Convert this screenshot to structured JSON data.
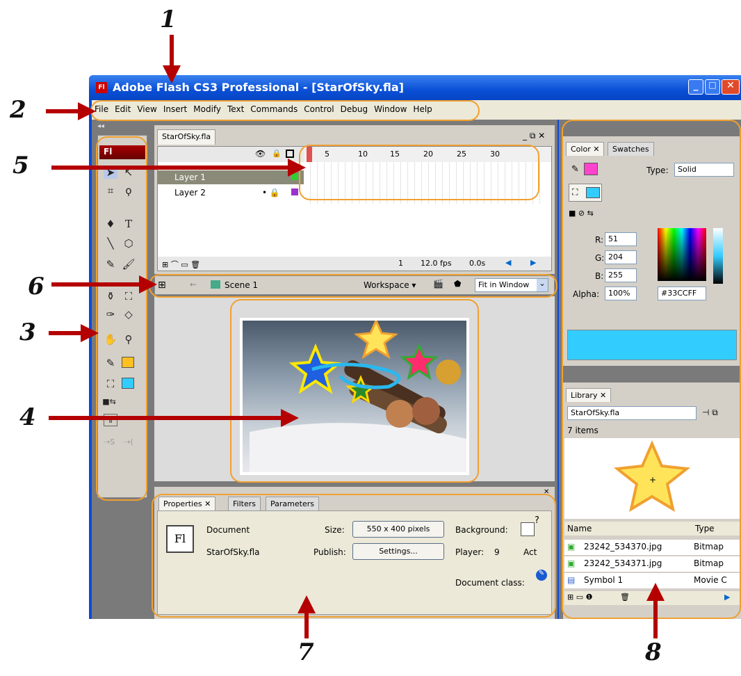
{
  "annotations": [
    "1",
    "2",
    "3",
    "4",
    "5",
    "6",
    "7",
    "8"
  ],
  "window": {
    "title": "Adobe Flash CS3 Professional - [StarOfSky.fla]",
    "app_icon": "Fl"
  },
  "menu": [
    "File",
    "Edit",
    "View",
    "Insert",
    "Modify",
    "Text",
    "Commands",
    "Control",
    "Debug",
    "Window",
    "Help"
  ],
  "toolbar": {
    "logo": "Fl",
    "collapse": "◂◂"
  },
  "document": {
    "tab": "StarOfSky.fla"
  },
  "timeline": {
    "frames": [
      "5",
      "10",
      "15",
      "20",
      "25",
      "30"
    ],
    "layers": [
      {
        "name": "Layer 1",
        "selected": true
      },
      {
        "name": "Layer 2",
        "selected": false
      }
    ],
    "current_frame": "1",
    "fps": "12.0 fps",
    "time": "0.0s"
  },
  "editbar": {
    "scene": "Scene 1",
    "workspace": "Workspace ▾",
    "zoom": "Fit in Window"
  },
  "properties": {
    "tabs": [
      "Properties",
      "Filters",
      "Parameters"
    ],
    "logo": "Fl",
    "doc_label": "Document",
    "doc_name": "StarOfSky.fla",
    "size_label": "Size:",
    "size_value": "550 x 400 pixels",
    "publish_label": "Publish:",
    "publish_value": "Settings...",
    "background_label": "Background:",
    "player_label": "Player:",
    "player_value": "9",
    "act": "Act",
    "doc_class_label": "Document class:"
  },
  "color": {
    "tabs": [
      "Color",
      "Swatches"
    ],
    "type_label": "Type:",
    "type_value": "Solid",
    "r_label": "R:",
    "r": "51",
    "g_label": "G:",
    "g": "204",
    "b_label": "B:",
    "b": "255",
    "alpha_label": "Alpha:",
    "alpha": "100%",
    "hex": "#33CCFF",
    "stroke_color": "#ff44cc",
    "fill_color": "#33ccff"
  },
  "library": {
    "tab": "Library",
    "file": "StarOfSky.fla",
    "count": "7 items",
    "col_name": "Name",
    "col_type": "Type",
    "items": [
      {
        "name": "23242_534370.jpg",
        "type": "Bitmap"
      },
      {
        "name": "23242_534371.jpg",
        "type": "Bitmap"
      },
      {
        "name": "Symbol 1",
        "type": "Movie C"
      }
    ]
  }
}
